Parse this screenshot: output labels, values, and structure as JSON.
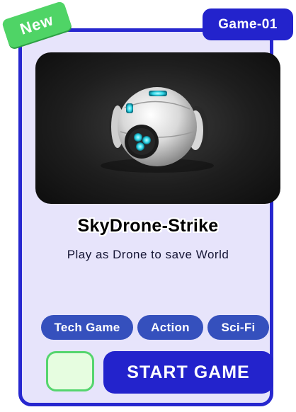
{
  "card": {
    "id_label": "Game-01",
    "new_label": "New",
    "title": "SkyDrone-Strike",
    "subtitle": "Play as Drone to save World",
    "tags": [
      "Tech Game",
      "Action",
      "Sci-Fi"
    ],
    "start_label": "START GAME",
    "image_icon": "drone-icon"
  },
  "colors": {
    "primary": "#2323cc",
    "card_bg": "#e7e4fb",
    "new_green": "#4fd466",
    "tag_blue": "#3550bd",
    "square_bg": "#e6fde0"
  }
}
